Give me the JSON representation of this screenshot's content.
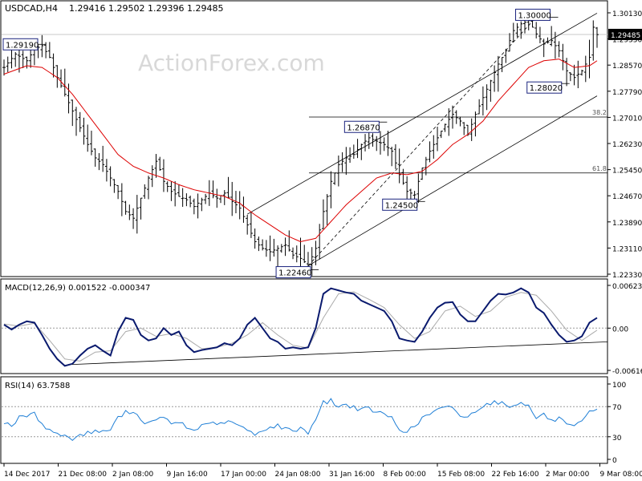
{
  "header": {
    "symbol": "USDCAD,H4",
    "ohlc": "1.29416 1.29502 1.29396 1.29485"
  },
  "watermark": "ActionForex.com",
  "colors": {
    "price": "#000000",
    "ma": "#dd0000",
    "macd": "#0a1a6e",
    "signal": "#aaaaaa",
    "rsi": "#1f7fd6",
    "grid_dashed": "#9a9a9a",
    "label_border": "#1a237e",
    "trend": "#000000"
  },
  "chart_data": [
    {
      "type": "line",
      "name": "price",
      "title": "USDCAD,H4",
      "ylim": [
        1.2233,
        1.3013
      ],
      "y_ticks": [
        "1.30130",
        "1.29350",
        "1.28570",
        "1.27790",
        "1.27010",
        "1.26230",
        "1.25450",
        "1.24670",
        "1.23890",
        "1.23110",
        "1.22330"
      ],
      "current_price": "1.29485",
      "x_dates": [
        "2017-12-14",
        "2017-12-21",
        "2018-01-02",
        "2018-01-09",
        "2018-01-17",
        "2018-01-24",
        "2018-01-31",
        "2018-02-08",
        "2018-02-15",
        "2018-02-22",
        "2018-03-02",
        "2018-03-09"
      ],
      "x_labels": [
        "14 Dec 2017",
        "21 Dec 08:00",
        "2 Jan 08:00",
        "9 Jan 16:00",
        "17 Jan 00:00",
        "24 Jan 08:00",
        "31 Jan 16:00",
        "8 Feb 00:00",
        "15 Feb 08:00",
        "22 Feb 16:00",
        "2 Mar 00:00",
        "9 Mar 08:00"
      ],
      "close_keypoints": [
        [
          0,
          1.285
        ],
        [
          3,
          1.289
        ],
        [
          6,
          1.287
        ],
        [
          8,
          1.2905
        ],
        [
          10,
          1.2915
        ],
        [
          12,
          1.288
        ],
        [
          14,
          1.282
        ],
        [
          16,
          1.277
        ],
        [
          18,
          1.272
        ],
        [
          20,
          1.267
        ],
        [
          22,
          1.262
        ],
        [
          24,
          1.258
        ],
        [
          26,
          1.256
        ],
        [
          28,
          1.252
        ],
        [
          30,
          1.248
        ],
        [
          32,
          1.242
        ],
        [
          34,
          1.24
        ],
        [
          36,
          1.246
        ],
        [
          38,
          1.252
        ],
        [
          40,
          1.257
        ],
        [
          41,
          1.2545
        ],
        [
          42,
          1.251
        ],
        [
          44,
          1.248
        ],
        [
          46,
          1.2465
        ],
        [
          48,
          1.2455
        ],
        [
          50,
          1.2435
        ],
        [
          52,
          1.2455
        ],
        [
          54,
          1.2475
        ],
        [
          56,
          1.246
        ],
        [
          58,
          1.2475
        ],
        [
          60,
          1.245
        ],
        [
          62,
          1.243
        ],
        [
          64,
          1.238
        ],
        [
          66,
          1.233
        ],
        [
          68,
          1.231
        ],
        [
          70,
          1.23
        ],
        [
          72,
          1.231
        ],
        [
          74,
          1.232
        ],
        [
          76,
          1.229
        ],
        [
          78,
          1.228
        ],
        [
          80,
          1.226
        ],
        [
          82,
          1.231
        ],
        [
          84,
          1.242
        ],
        [
          86,
          1.251
        ],
        [
          88,
          1.256
        ],
        [
          90,
          1.258
        ],
        [
          92,
          1.259
        ],
        [
          94,
          1.262
        ],
        [
          96,
          1.264
        ],
        [
          98,
          1.263
        ],
        [
          100,
          1.262
        ],
        [
          102,
          1.26
        ],
        [
          104,
          1.253
        ],
        [
          106,
          1.248
        ],
        [
          108,
          1.247
        ],
        [
          110,
          1.255
        ],
        [
          112,
          1.26
        ],
        [
          114,
          1.264
        ],
        [
          116,
          1.268
        ],
        [
          118,
          1.271
        ],
        [
          120,
          1.269
        ],
        [
          122,
          1.265
        ],
        [
          124,
          1.271
        ],
        [
          126,
          1.276
        ],
        [
          128,
          1.281
        ],
        [
          130,
          1.286
        ],
        [
          132,
          1.29
        ],
        [
          134,
          1.296
        ],
        [
          136,
          1.298
        ],
        [
          138,
          1.299
        ],
        [
          140,
          1.295
        ],
        [
          142,
          1.292
        ],
        [
          144,
          1.293
        ],
        [
          146,
          1.29
        ],
        [
          148,
          1.284
        ],
        [
          150,
          1.282
        ],
        [
          152,
          1.284
        ],
        [
          154,
          1.288
        ],
        [
          155,
          1.297
        ],
        [
          156,
          1.2948
        ]
      ],
      "ma_keypoints": [
        [
          0,
          1.283
        ],
        [
          6,
          1.2855
        ],
        [
          10,
          1.285
        ],
        [
          14,
          1.282
        ],
        [
          18,
          1.277
        ],
        [
          22,
          1.271
        ],
        [
          26,
          1.265
        ],
        [
          30,
          1.259
        ],
        [
          34,
          1.2555
        ],
        [
          38,
          1.2535
        ],
        [
          42,
          1.252
        ],
        [
          46,
          1.25
        ],
        [
          50,
          1.2485
        ],
        [
          54,
          1.2475
        ],
        [
          58,
          1.2465
        ],
        [
          62,
          1.2445
        ],
        [
          66,
          1.241
        ],
        [
          70,
          1.238
        ],
        [
          74,
          1.235
        ],
        [
          78,
          1.233
        ],
        [
          82,
          1.234
        ],
        [
          86,
          1.239
        ],
        [
          90,
          1.244
        ],
        [
          94,
          1.248
        ],
        [
          98,
          1.252
        ],
        [
          102,
          1.2535
        ],
        [
          106,
          1.253
        ],
        [
          110,
          1.254
        ],
        [
          114,
          1.2575
        ],
        [
          118,
          1.262
        ],
        [
          122,
          1.265
        ],
        [
          126,
          1.269
        ],
        [
          130,
          1.275
        ],
        [
          134,
          1.28
        ],
        [
          138,
          1.285
        ],
        [
          142,
          1.287
        ],
        [
          146,
          1.2875
        ],
        [
          150,
          1.285
        ],
        [
          154,
          1.2855
        ],
        [
          156,
          1.287
        ]
      ],
      "levels": [
        {
          "label": "1.29190",
          "value": 1.2919
        },
        {
          "label": "1.30000",
          "value": 1.3
        },
        {
          "label": "1.28020",
          "value": 1.2802
        },
        {
          "label": "1.26870",
          "value": 1.2687
        },
        {
          "label": "1.24500",
          "value": 1.245
        },
        {
          "label": "1.22460",
          "value": 1.2246
        }
      ],
      "fibonacci": [
        {
          "label": "38.2",
          "value": 1.2702
        },
        {
          "label": "61.8",
          "value": 1.2535
        }
      ],
      "channel_lines": [
        {
          "from": [
            64,
            1.2412
          ],
          "to": [
            156,
            1.3012
          ]
        },
        {
          "from": [
            80,
            1.2258
          ],
          "to": [
            156,
            1.2765
          ]
        }
      ],
      "dashed_trend": {
        "from": [
          80,
          1.2258
        ],
        "to": [
          140,
          1.3
        ]
      }
    },
    {
      "type": "line",
      "name": "macd",
      "title": "MACD(12,26,9) 0.001522 -0.000347",
      "ylim": [
        -0.00616,
        0.00623
      ],
      "y_ticks": [
        "0.006232",
        "0.00",
        "-0.006163"
      ],
      "macd_keypoints": [
        [
          0,
          0.0005
        ],
        [
          2,
          -0.0002
        ],
        [
          4,
          0.0005
        ],
        [
          6,
          0.001
        ],
        [
          8,
          0.0008
        ],
        [
          10,
          -0.001
        ],
        [
          12,
          -0.003
        ],
        [
          14,
          -0.0045
        ],
        [
          16,
          -0.0055
        ],
        [
          18,
          -0.0052
        ],
        [
          20,
          -0.004
        ],
        [
          22,
          -0.003
        ],
        [
          24,
          -0.0025
        ],
        [
          26,
          -0.0033
        ],
        [
          28,
          -0.004
        ],
        [
          30,
          -0.0005
        ],
        [
          32,
          0.0015
        ],
        [
          34,
          0.0012
        ],
        [
          36,
          -0.001
        ],
        [
          38,
          -0.0018
        ],
        [
          40,
          -0.0015
        ],
        [
          42,
          0.0
        ],
        [
          44,
          -0.001
        ],
        [
          46,
          -0.0005
        ],
        [
          48,
          -0.0025
        ],
        [
          50,
          -0.0035
        ],
        [
          52,
          -0.0032
        ],
        [
          54,
          -0.003
        ],
        [
          56,
          -0.0028
        ],
        [
          58,
          -0.0022
        ],
        [
          60,
          -0.0025
        ],
        [
          62,
          -0.0015
        ],
        [
          64,
          0.0005
        ],
        [
          66,
          0.0015
        ],
        [
          68,
          0.0
        ],
        [
          70,
          -0.0015
        ],
        [
          72,
          -0.002
        ],
        [
          74,
          -0.003
        ],
        [
          76,
          -0.0028
        ],
        [
          78,
          -0.003
        ],
        [
          80,
          -0.0028
        ],
        [
          82,
          0.0
        ],
        [
          84,
          0.005
        ],
        [
          86,
          0.0058
        ],
        [
          88,
          0.0055
        ],
        [
          90,
          0.0052
        ],
        [
          92,
          0.005
        ],
        [
          94,
          0.004
        ],
        [
          96,
          0.0035
        ],
        [
          98,
          0.003
        ],
        [
          100,
          0.0025
        ],
        [
          102,
          0.001
        ],
        [
          104,
          -0.0015
        ],
        [
          106,
          -0.0018
        ],
        [
          108,
          -0.002
        ],
        [
          110,
          -0.0005
        ],
        [
          112,
          0.0015
        ],
        [
          114,
          0.003
        ],
        [
          116,
          0.0037
        ],
        [
          118,
          0.0038
        ],
        [
          120,
          0.002
        ],
        [
          122,
          0.001
        ],
        [
          124,
          0.001
        ],
        [
          126,
          0.0025
        ],
        [
          128,
          0.004
        ],
        [
          130,
          0.005
        ],
        [
          132,
          0.0049
        ],
        [
          134,
          0.0052
        ],
        [
          136,
          0.0058
        ],
        [
          138,
          0.0052
        ],
        [
          140,
          0.003
        ],
        [
          142,
          0.0022
        ],
        [
          144,
          0.0005
        ],
        [
          146,
          -0.001
        ],
        [
          148,
          -0.002
        ],
        [
          150,
          -0.0018
        ],
        [
          152,
          -0.0012
        ],
        [
          154,
          0.0008
        ],
        [
          156,
          0.0015
        ]
      ],
      "signal_keypoints": [
        [
          0,
          0.0006
        ],
        [
          4,
          0.0003
        ],
        [
          8,
          0.0007
        ],
        [
          12,
          -0.0018
        ],
        [
          16,
          -0.0045
        ],
        [
          20,
          -0.0048
        ],
        [
          24,
          -0.0035
        ],
        [
          28,
          -0.0033
        ],
        [
          32,
          -0.0005
        ],
        [
          36,
          0.0
        ],
        [
          40,
          -0.0012
        ],
        [
          44,
          -0.0008
        ],
        [
          48,
          -0.0015
        ],
        [
          52,
          -0.003
        ],
        [
          56,
          -0.0028
        ],
        [
          60,
          -0.0022
        ],
        [
          64,
          -0.001
        ],
        [
          68,
          0.0008
        ],
        [
          72,
          -0.001
        ],
        [
          76,
          -0.0025
        ],
        [
          80,
          -0.0029
        ],
        [
          84,
          0.0015
        ],
        [
          88,
          0.005
        ],
        [
          92,
          0.0053
        ],
        [
          96,
          0.0042
        ],
        [
          100,
          0.003
        ],
        [
          104,
          0.0005
        ],
        [
          108,
          -0.0015
        ],
        [
          112,
          -0.0005
        ],
        [
          116,
          0.0025
        ],
        [
          120,
          0.0032
        ],
        [
          124,
          0.0017
        ],
        [
          128,
          0.0025
        ],
        [
          132,
          0.0045
        ],
        [
          136,
          0.0052
        ],
        [
          140,
          0.0048
        ],
        [
          144,
          0.0025
        ],
        [
          148,
          -0.0003
        ],
        [
          152,
          -0.0018
        ],
        [
          156,
          -0.0003
        ]
      ],
      "trend_line": {
        "from": [
          18,
          -0.0053
        ],
        "to": [
          156,
          -0.002
        ]
      }
    },
    {
      "type": "line",
      "name": "rsi",
      "title": "RSI(14) 63.7588",
      "ylim": [
        0,
        100
      ],
      "y_ticks": [
        "100",
        "70",
        "30",
        "0"
      ],
      "levels": [
        70,
        30
      ],
      "rsi_keypoints": [
        [
          0,
          50
        ],
        [
          2,
          45
        ],
        [
          4,
          55
        ],
        [
          6,
          58
        ],
        [
          8,
          60
        ],
        [
          10,
          48
        ],
        [
          12,
          38
        ],
        [
          14,
          35
        ],
        [
          16,
          30
        ],
        [
          18,
          28
        ],
        [
          20,
          32
        ],
        [
          22,
          35
        ],
        [
          24,
          38
        ],
        [
          26,
          36
        ],
        [
          28,
          40
        ],
        [
          30,
          55
        ],
        [
          32,
          62
        ],
        [
          34,
          65
        ],
        [
          36,
          52
        ],
        [
          38,
          48
        ],
        [
          40,
          50
        ],
        [
          42,
          58
        ],
        [
          44,
          45
        ],
        [
          46,
          50
        ],
        [
          48,
          42
        ],
        [
          50,
          38
        ],
        [
          52,
          45
        ],
        [
          54,
          50
        ],
        [
          56,
          44
        ],
        [
          58,
          50
        ],
        [
          60,
          48
        ],
        [
          62,
          45
        ],
        [
          64,
          38
        ],
        [
          66,
          32
        ],
        [
          68,
          40
        ],
        [
          70,
          42
        ],
        [
          72,
          45
        ],
        [
          74,
          40
        ],
        [
          76,
          38
        ],
        [
          78,
          42
        ],
        [
          80,
          35
        ],
        [
          82,
          55
        ],
        [
          84,
          75
        ],
        [
          86,
          78
        ],
        [
          88,
          70
        ],
        [
          90,
          72
        ],
        [
          92,
          70
        ],
        [
          94,
          65
        ],
        [
          96,
          68
        ],
        [
          98,
          62
        ],
        [
          100,
          60
        ],
        [
          102,
          55
        ],
        [
          104,
          40
        ],
        [
          106,
          38
        ],
        [
          108,
          42
        ],
        [
          110,
          55
        ],
        [
          112,
          60
        ],
        [
          114,
          65
        ],
        [
          116,
          68
        ],
        [
          118,
          70
        ],
        [
          120,
          58
        ],
        [
          122,
          55
        ],
        [
          124,
          65
        ],
        [
          126,
          72
        ],
        [
          128,
          75
        ],
        [
          130,
          76
        ],
        [
          132,
          72
        ],
        [
          134,
          70
        ],
        [
          136,
          78
        ],
        [
          138,
          70
        ],
        [
          140,
          55
        ],
        [
          142,
          60
        ],
        [
          144,
          50
        ],
        [
          146,
          55
        ],
        [
          148,
          45
        ],
        [
          150,
          42
        ],
        [
          152,
          50
        ],
        [
          154,
          62
        ],
        [
          156,
          64
        ]
      ]
    }
  ]
}
